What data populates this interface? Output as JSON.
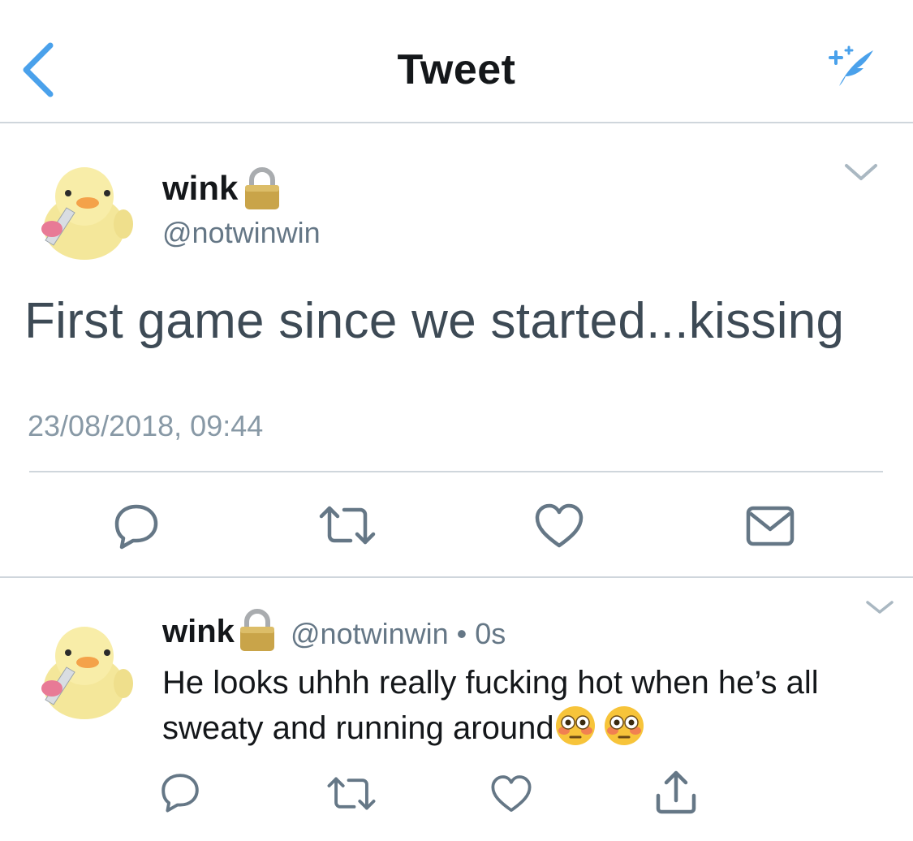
{
  "nav": {
    "title": "Tweet",
    "back_icon": "chevron-left-icon",
    "compose_icon": "compose-quill-icon"
  },
  "main_tweet": {
    "author": {
      "name": "wink",
      "handle": "@notwinwin",
      "protected_icon": "lock-icon"
    },
    "text": "First game since we started...kissing",
    "timestamp": "23/08/2018, 09:44",
    "actions": [
      "reply-icon",
      "retweet-icon",
      "like-icon",
      "direct-message-icon"
    ]
  },
  "reply_tweet": {
    "author": {
      "name": "wink",
      "handle": "@notwinwin",
      "separator": "•",
      "age": "0s"
    },
    "text": "He looks uhhh really fucking hot when he’s all sweaty and running around",
    "emojis": [
      "flushed-face",
      "flushed-face"
    ],
    "actions": [
      "reply-icon",
      "retweet-icon",
      "like-icon",
      "share-icon"
    ]
  },
  "colors": {
    "accent": "#4aa1eb",
    "icon_gray": "#657786",
    "divider": "#cfd6dc",
    "timestamp": "#8899a6"
  }
}
